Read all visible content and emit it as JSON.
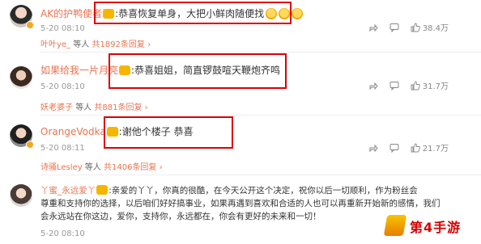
{
  "comments": [
    {
      "username": "AK的护鸭使者",
      "text": ":恭喜恢复单身，大把小鲜肉随便找",
      "time": "5-20 08:10",
      "shares": "",
      "comments_count": "",
      "likes": "38.4万",
      "reply_user": "叶叶ye_",
      "reply_text": "等人",
      "reply_count": "共1892条回复"
    },
    {
      "username": "如果给我一片月亮",
      "text": ":恭喜姐姐，简直锣鼓喧天鞭炮齐鸣",
      "time": "5-20 08:10",
      "likes": "31.7万",
      "reply_user": "妖老婆子",
      "reply_text": "等人",
      "reply_count": "共881条回复"
    },
    {
      "username": "OrangeVodka",
      "text": ":谢他个楼子 恭喜",
      "time": "5-20 08:11",
      "likes": "21.7万",
      "reply_user": "诗骚Lesley",
      "reply_text": "等人",
      "reply_count": "共1406条回复"
    },
    {
      "username": "丫蜜_永远爱丫",
      "text": ":亲爱的丫丫，你真的很酷，在今天公开这个决定，祝你以后一切顺利，作为粉丝会尊重和支持你的选择，以后咱们好好搞事业，如果再遇到喜欢和合适的人也可以再重新开始新的感情，我们会永远站在你这边，爱你，支持你，永远都在，你会有更好的未来和一切！",
      "line1": ":亲爱的丫丫，你真的很酷，在今天公开这个决定，祝你以后一切顺利，作为粉丝会",
      "line2": "尊重和支持你的选择，以后咱们好好搞事业，如果再遇到喜欢和合适的人也可以再重新开始新的感情，我们",
      "line3": "会永远站在你这边，爱你，支持你，永远都在，你会有更好的未来和一切！",
      "time": "5-20 08:10"
    }
  ],
  "logo": {
    "brand": "第4手游",
    "sub": ""
  },
  "colors": {
    "accent": "#eb7350",
    "highlight": "#dd0000",
    "vip": "#f7b500"
  },
  "icons": [
    "share-icon",
    "comment-icon",
    "like-icon"
  ]
}
